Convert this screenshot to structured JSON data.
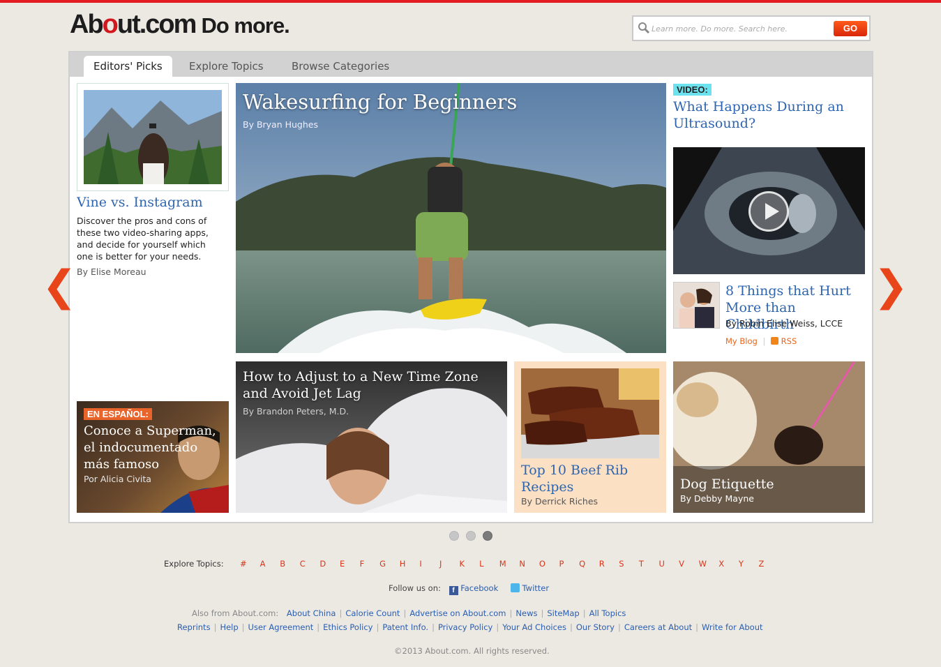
{
  "header": {
    "logo_brand_pre": "Ab",
    "logo_brand_dot": "o",
    "logo_brand_post": "ut.com",
    "logo_tagline": "Do more.",
    "search_placeholder": "Learn more. Do more. Search here.",
    "go_label": "GO"
  },
  "tabs": [
    {
      "label": "Editors' Picks",
      "active": true
    },
    {
      "label": "Explore Topics",
      "active": false
    },
    {
      "label": "Browse Categories",
      "active": false
    }
  ],
  "left_feature": {
    "title": "Vine vs. Instagram",
    "description": "Discover the pros and cons of these two video-sharing apps, and decide for yourself which one is better for your needs.",
    "byline": "By Elise Moreau"
  },
  "spanish_feature": {
    "badge": "EN ESPAÑOL:",
    "title": "Conoce a Superman, el indocumentado más famoso",
    "byline": "Por Alicia Civita"
  },
  "hero": {
    "title": "Wakesurfing for Beginners",
    "byline": "By Bryan Hughes"
  },
  "video_feature": {
    "badge": "VIDEO:",
    "title": "What Happens During an Ultrasound?"
  },
  "blog_feature": {
    "title": "8 Things that Hurt More than Childbirth",
    "byline": "By Robin Elise Weiss, LCCE",
    "blog_link": "My Blog",
    "rss_link": "RSS"
  },
  "jetlag_feature": {
    "title": "How to Adjust to a New Time Zone and Avoid Jet Lag",
    "byline": "By Brandon Peters, M.D."
  },
  "ribs_feature": {
    "title": "Top 10 Beef Rib Recipes",
    "byline": "By Derrick Riches"
  },
  "dog_feature": {
    "title": "Dog Etiquette",
    "byline": "By Debby Mayne"
  },
  "pager": {
    "count": 3,
    "active_index": 2
  },
  "explore": {
    "label": "Explore Topics:",
    "letters": [
      "#",
      "A",
      "B",
      "C",
      "D",
      "E",
      "F",
      "G",
      "H",
      "I",
      "J",
      "K",
      "L",
      "M",
      "N",
      "O",
      "P",
      "Q",
      "R",
      "S",
      "T",
      "U",
      "V",
      "W",
      "X",
      "Y",
      "Z"
    ]
  },
  "follow": {
    "label": "Follow us on:",
    "facebook": "Facebook",
    "twitter": "Twitter"
  },
  "also_from": {
    "label": "Also from About.com:",
    "links": [
      "About China",
      "Calorie Count",
      "Advertise on About.com",
      "News",
      "SiteMap",
      "All Topics"
    ]
  },
  "footer_links": [
    "Reprints",
    "Help",
    "User Agreement",
    "Ethics Policy",
    "Patent Info.",
    "Privacy Policy",
    "Your Ad Choices",
    "Our Story",
    "Careers at About",
    "Write for About"
  ],
  "copyright": "©2013 About.com. All rights reserved.",
  "colors": {
    "accent_red": "#e31b23",
    "link_blue": "#2e65b0",
    "orange": "#e8451b",
    "video_badge": "#6ce2ef"
  }
}
